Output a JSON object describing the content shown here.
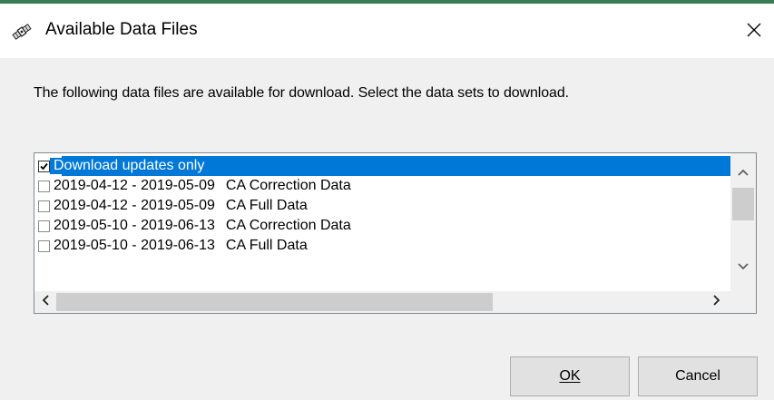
{
  "window": {
    "title": "Available Data Files",
    "icon": "satellite-icon",
    "close_icon": "close-icon"
  },
  "instructions": "The following data files are available for download.  Select the data sets to download.",
  "list": {
    "items": [
      {
        "checked": true,
        "selected": true,
        "text": "Download updates only"
      },
      {
        "checked": false,
        "selected": false,
        "range": "2019-04-12 - 2019-05-09",
        "type": "CA Correction Data"
      },
      {
        "checked": false,
        "selected": false,
        "range": "2019-04-12 - 2019-05-09",
        "type": "CA Full Data"
      },
      {
        "checked": false,
        "selected": false,
        "range": "2019-05-10 - 2019-06-13",
        "type": "CA Correction Data"
      },
      {
        "checked": false,
        "selected": false,
        "range": "2019-05-10 - 2019-06-13",
        "type": "CA Full Data"
      }
    ],
    "scroll_icons": [
      "chevron-up-icon",
      "chevron-down-icon",
      "chevron-left-icon",
      "chevron-right-icon"
    ]
  },
  "buttons": {
    "ok_label": "OK",
    "cancel_label": "Cancel"
  },
  "colors": {
    "selection": "#0078d7",
    "dialog_bg": "#f0f0f0",
    "titlebar_bg": "#ffffff"
  }
}
